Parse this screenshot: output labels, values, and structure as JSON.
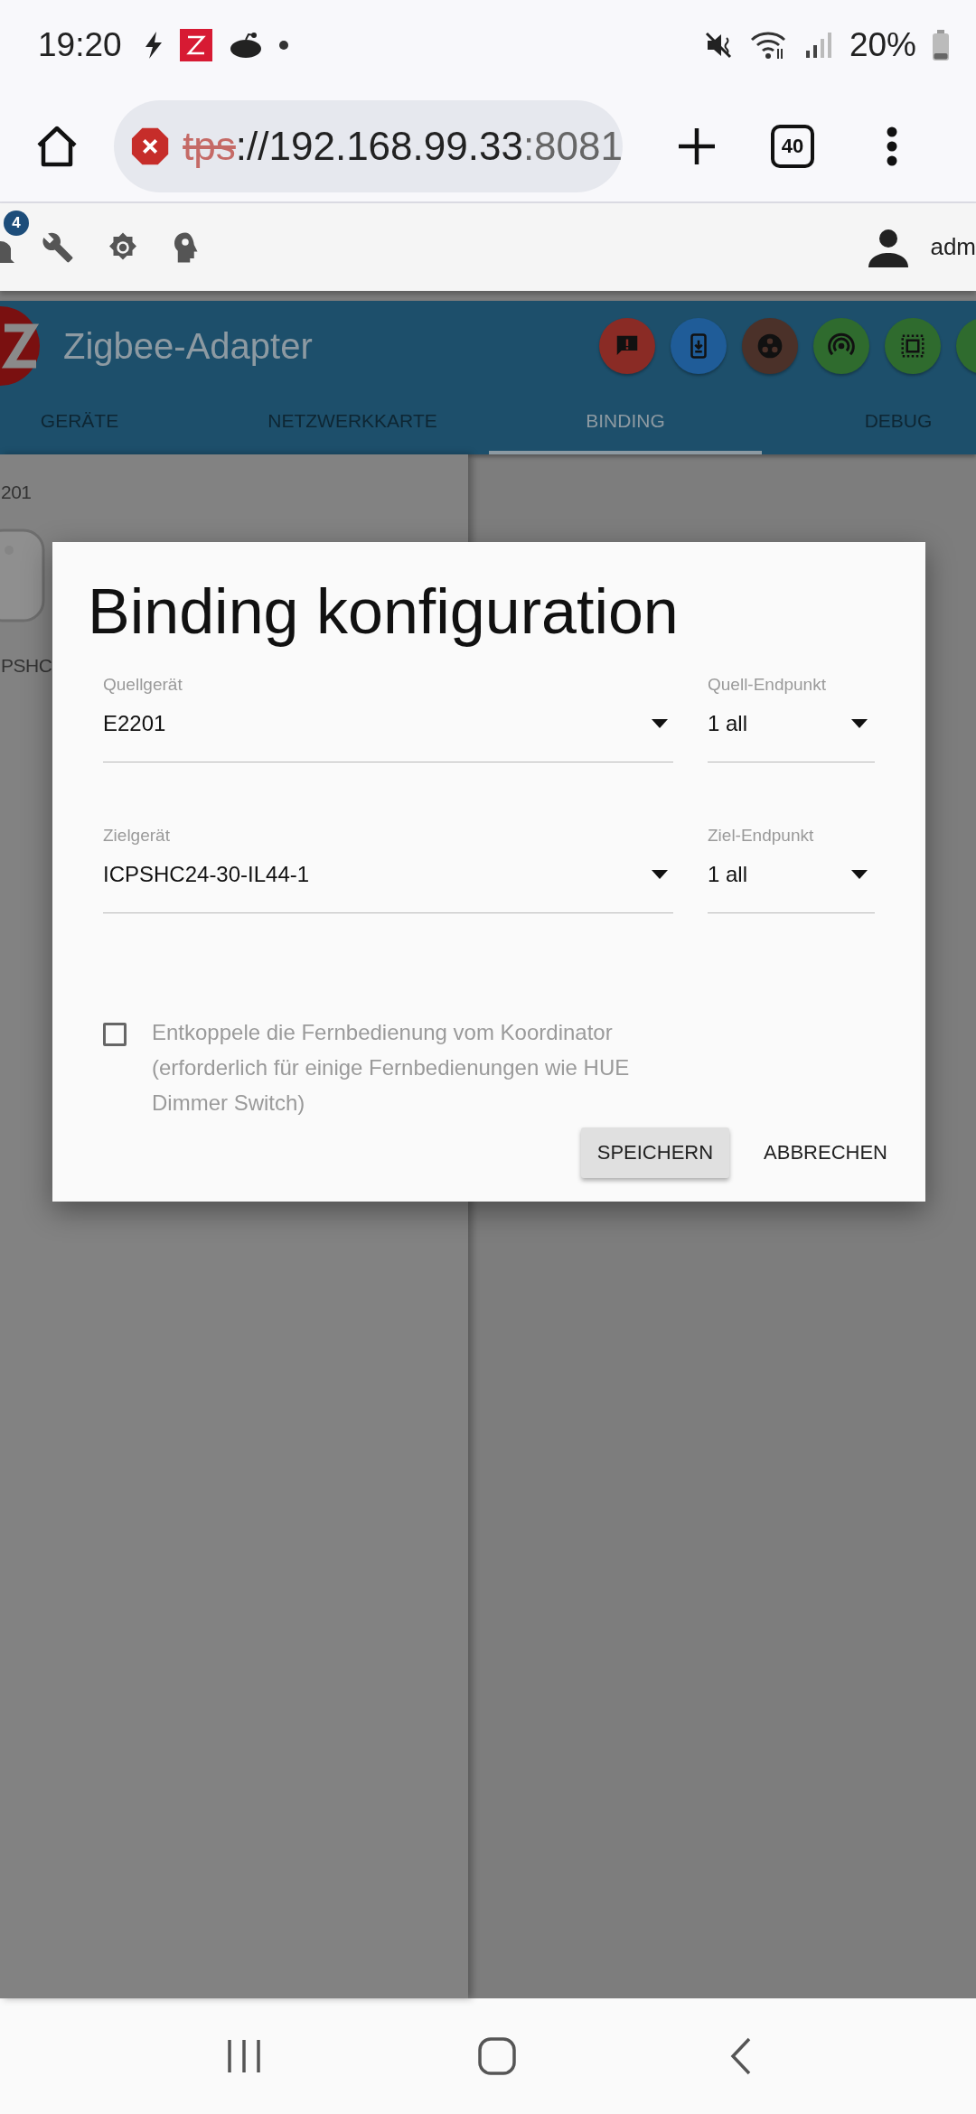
{
  "status_bar": {
    "time": "19:20",
    "battery": "20%"
  },
  "browser": {
    "url_scheme": "tps",
    "url_host": "://192.168.99.33",
    "url_port": ":8081",
    "tab_count": "40"
  },
  "toolbar": {
    "notification_count": "4",
    "user": "adm"
  },
  "app": {
    "title": "Zigbee-Adapter",
    "actions": [
      {
        "kind": "alert",
        "color": "#8a2b25"
      },
      {
        "kind": "phone",
        "color": "#1f5c98"
      },
      {
        "kind": "dots",
        "color": "#4b3129"
      },
      {
        "kind": "signal",
        "color": "#2f6b2e"
      },
      {
        "kind": "chip",
        "color": "#2f6b2e"
      },
      {
        "kind": "partial",
        "color": "#2f6b2e"
      }
    ],
    "tabs": [
      {
        "label": "GERÄTE",
        "selected": false
      },
      {
        "label": "NETZWERKKARTE",
        "selected": false
      },
      {
        "label": "BINDING",
        "selected": true
      },
      {
        "label": "DEBUG",
        "selected": false
      }
    ]
  },
  "devices": [
    {
      "name": "201"
    },
    {
      "name": "PSHC"
    }
  ],
  "dialog": {
    "title": "Binding konfiguration",
    "fields": [
      {
        "label": "Quellgerät",
        "value": "E2201",
        "kind": "wide"
      },
      {
        "label": "Quell-Endpunkt",
        "value": "1 all",
        "kind": "narrow"
      },
      {
        "label": "Zielgerät",
        "value": "ICPSHC24-30-IL44-1",
        "kind": "wide"
      },
      {
        "label": "Ziel-Endpunkt",
        "value": "1 all",
        "kind": "narrow"
      }
    ],
    "checkbox": {
      "label": "Entkoppele die Fernbedienung vom Koordinator (erforderlich für einige Fernbedienungen wie HUE Dimmer Switch)",
      "checked": false
    },
    "buttons": [
      {
        "label": "SPEICHERN",
        "kind": "raised"
      },
      {
        "label": "ABBRECHEN",
        "kind": "flat"
      }
    ]
  }
}
